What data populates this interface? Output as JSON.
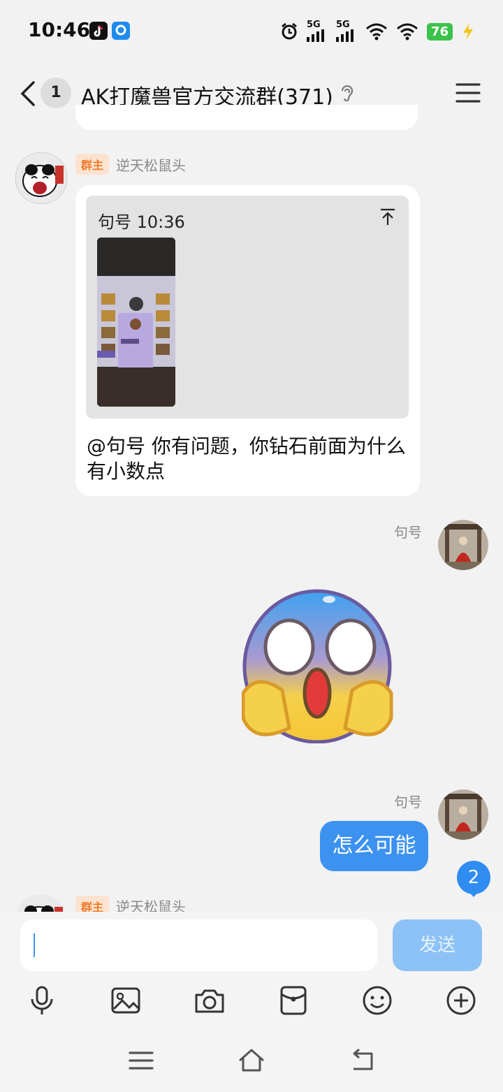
{
  "status_bar": {
    "time": "10:46",
    "battery": "76",
    "network_1": "5G",
    "network_2": "5G"
  },
  "header": {
    "unread_count": "1",
    "title": "AK打魔兽官方交流群(371)"
  },
  "messages": [
    {
      "sender": "逆天松鼠头",
      "role_badge": "群主",
      "quote": {
        "author_time": "句号 10:36"
      },
      "text": "@句号 你有问题，你钻石前面为什么有小数点"
    },
    {
      "sender": "句号",
      "type": "sticker",
      "sticker": "shocked-face-emoji"
    },
    {
      "sender": "句号",
      "text": "怎么可能"
    },
    {
      "sender": "逆天松鼠头",
      "role_badge": "群主"
    }
  ],
  "new_message_badge": "2",
  "composer": {
    "placeholder": "",
    "send_label": "发送"
  },
  "toolbar": [
    "mic-icon",
    "image-icon",
    "camera-icon",
    "red-packet-icon",
    "emoji-icon",
    "plus-icon"
  ],
  "nav": [
    "menu-icon",
    "home-icon",
    "back-icon"
  ],
  "colors": {
    "accent": "#3d92f0",
    "owner_badge_bg": "#fde3cf",
    "owner_badge_text": "#f07a2b"
  }
}
